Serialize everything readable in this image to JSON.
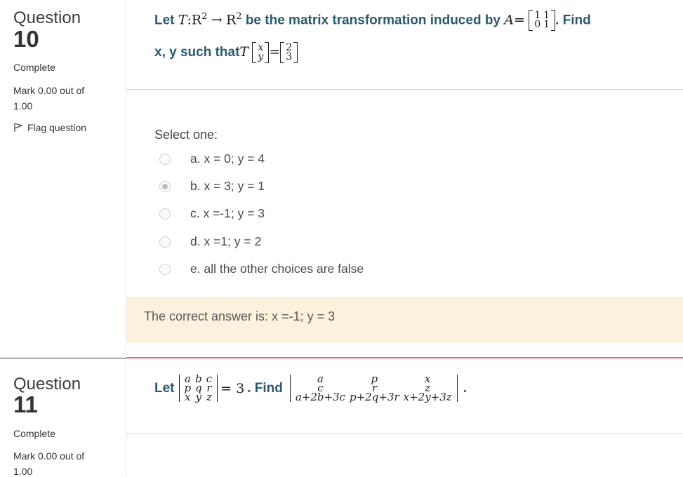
{
  "q10": {
    "word": "Question",
    "number": "10",
    "status": "Complete",
    "mark_line1": "Mark 0.00 out of",
    "mark_line2": "1.00",
    "flag_label": "Flag question",
    "text_let": "Let",
    "text_T": "T",
    "text_colon_map": ":R",
    "text_sup2a": "2",
    "text_arrow": "→",
    "text_R": "R",
    "text_sup2b": "2",
    "text_induced": "be the matrix transformation induced by",
    "text_A": "A",
    "text_eq": "=",
    "matrix_A": [
      [
        "1",
        "1"
      ],
      [
        "0",
        "1"
      ]
    ],
    "text_find": ". Find",
    "text_line2": "x, y such that",
    "vector_xy": [
      "x",
      "y"
    ],
    "vector_result": [
      "2",
      "3"
    ],
    "select_one": "Select one:",
    "options": [
      {
        "label": "a. x = 0; y = 4",
        "checked": false
      },
      {
        "label": "b. x = 3; y = 1",
        "checked": true
      },
      {
        "label": "c. x =-1; y = 3",
        "checked": false
      },
      {
        "label": "d. x =1; y = 2",
        "checked": false
      },
      {
        "label": "e. all the other choices are false",
        "checked": false
      }
    ],
    "feedback": "The correct answer is: x =-1; y = 3"
  },
  "q11": {
    "word": "Question",
    "number": "11",
    "status": "Complete",
    "mark_line1": "Mark 0.00 out of",
    "mark_line2": "1.00",
    "text_let": "Let",
    "det1": [
      [
        "a",
        "b",
        "c"
      ],
      [
        "p",
        "q",
        "r"
      ],
      [
        "x",
        "y",
        "z"
      ]
    ],
    "text_eq3": "= 3",
    "text_find": ". Find",
    "det2": [
      [
        "a",
        "p",
        "x"
      ],
      [
        "c",
        "r",
        "z"
      ],
      [
        "a+2b+3c",
        "p+2q+3r",
        "x+2y+3z"
      ]
    ],
    "text_period": "."
  }
}
